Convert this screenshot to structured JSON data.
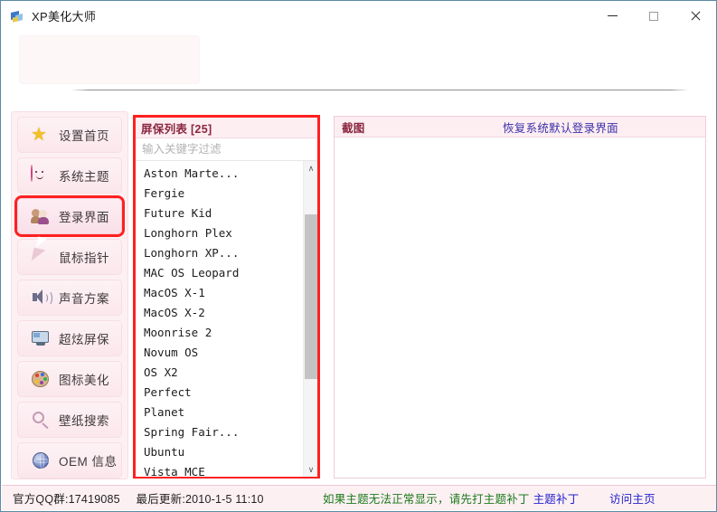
{
  "window": {
    "title": "XP美化大师",
    "icon": "app-palette-icon",
    "controls": {
      "minimize": "—",
      "maximize": "□",
      "close": "×"
    }
  },
  "sidebar": {
    "items": [
      {
        "label": "设置首页",
        "icon": "star-icon",
        "active": false
      },
      {
        "label": "系统主题",
        "icon": "monkey-face-icon",
        "active": false
      },
      {
        "label": "登录界面",
        "icon": "users-icon",
        "active": true
      },
      {
        "label": "鼠标指针",
        "icon": "cursor-icon",
        "active": false
      },
      {
        "label": "声音方案",
        "icon": "speaker-icon",
        "active": false
      },
      {
        "label": "超炫屏保",
        "icon": "monitor-icon",
        "active": false
      },
      {
        "label": "图标美化",
        "icon": "palette-icon",
        "active": false
      },
      {
        "label": "壁纸搜索",
        "icon": "magnifier-icon",
        "active": false
      },
      {
        "label": "OEM 信息",
        "icon": "globe-icon",
        "active": false
      }
    ]
  },
  "list_panel": {
    "header": "屏保列表 [25]",
    "filter_placeholder": "输入关键字过滤",
    "filter_value": "",
    "items": [
      "Aston Marte...",
      "Fergie",
      "Future Kid",
      "Longhorn Plex",
      "Longhorn XP...",
      "MAC OS Leopard",
      "MacOS X-1",
      "MacOS X-2",
      "Moonrise 2",
      "Novum OS",
      "OS X2",
      "Perfect",
      "Planet",
      "Spring Fair...",
      "Ubuntu",
      "Vista MCE"
    ],
    "scroll": {
      "up_arrow": "∧",
      "down_arrow": "∨",
      "thumb_top_pct": 17,
      "thumb_height_pct": 52
    }
  },
  "right_panel": {
    "title": "截图",
    "action_link": "恢复系统默认登录界面",
    "preview": ""
  },
  "status_bar": {
    "qq_group": "官方QQ群:17419085",
    "last_update": "最后更新:2010-1-5 11:10",
    "notice": "如果主题无法正常显示，请先打主题补丁",
    "patch_link": "主题补丁",
    "home_link": "访问主页"
  },
  "colors": {
    "accent_red": "#ff2020",
    "panel_pink": "#fdf0f3",
    "header_pink": "#fdeef2",
    "header_text": "#8b2640",
    "link_blue": "#2222cc",
    "notice_green": "#1a7a1a"
  }
}
